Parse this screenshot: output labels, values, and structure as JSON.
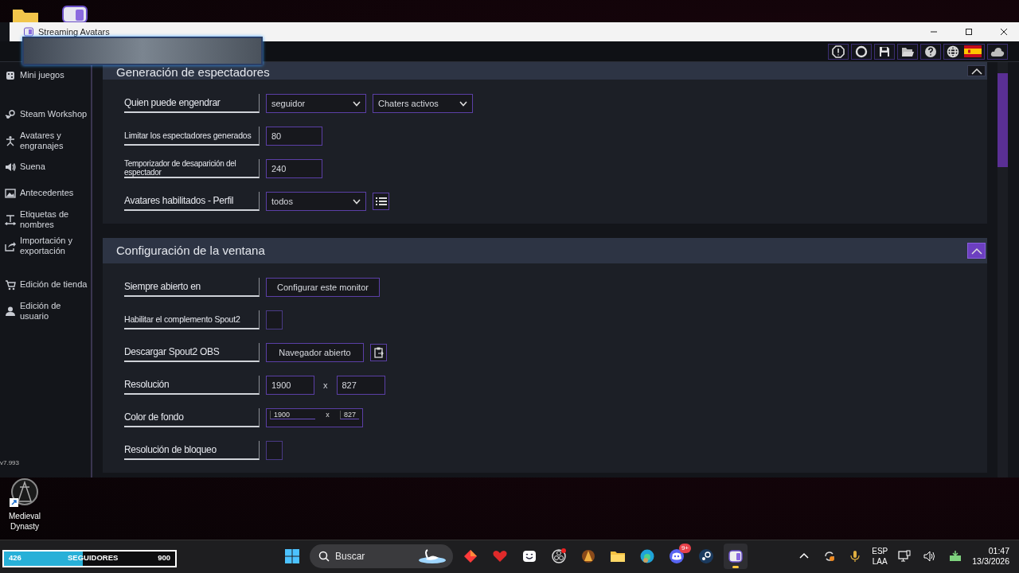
{
  "window": {
    "title": "Streaming Avatars"
  },
  "sidebar": {
    "groups": [
      {
        "items": [
          {
            "label": "Mini juegos"
          }
        ]
      },
      {
        "items": [
          {
            "label": "Steam Workshop"
          },
          {
            "label": "Avatares y engranajes"
          },
          {
            "label": "Suena"
          },
          {
            "label": "Antecedentes"
          },
          {
            "label": "Etiquetas de nombres"
          },
          {
            "label": "Importación y exportación"
          }
        ]
      },
      {
        "items": [
          {
            "label": "Edición de tienda"
          },
          {
            "label": "Edición de usuario"
          }
        ]
      }
    ]
  },
  "sections": [
    {
      "title": "Generación de espectadores",
      "expanded": true,
      "highlighted": false,
      "rows": [
        {
          "label": "Quien puede engendrar",
          "kind": "dropdown",
          "values": [
            "seguidor",
            "Chaters activos"
          ]
        },
        {
          "label": "Limitar los espectadores generados",
          "kind": "number",
          "values": [
            "80"
          ]
        },
        {
          "label": "Temporizador de desaparición del espectador",
          "kind": "number",
          "values": [
            "240"
          ]
        },
        {
          "label": "Avatares habilitados - Perfil",
          "kind": "dropdown_with_list",
          "values": [
            "todos"
          ]
        }
      ]
    },
    {
      "title": "Configuración de la ventana",
      "expanded": true,
      "highlighted": true,
      "rows": [
        {
          "label": "Siempre abierto en",
          "kind": "button",
          "values": [
            "Configurar este monitor"
          ]
        },
        {
          "label": "Habilitar el complemento Spout2",
          "kind": "checkbox",
          "checked": false
        },
        {
          "label": "Descargar Spout2 OBS",
          "kind": "button_with_clipboard",
          "values": [
            "Navegador abierto"
          ]
        },
        {
          "label": "Resolución",
          "kind": "size_pair",
          "values": [
            "1900",
            "827"
          ],
          "separator": "x"
        },
        {
          "label": "Color de fondo",
          "kind": "color_pair",
          "values": [
            "1900",
            "827"
          ],
          "separator": "x"
        },
        {
          "label": "Resolución de bloqueo",
          "kind": "checkbox",
          "checked": false
        }
      ]
    }
  ],
  "desktop": {
    "version": "v7.993",
    "shortcut": "Medieval Dynasty"
  },
  "taskbar": {
    "follower_meter": {
      "current": "426",
      "label": "SEGUIDORES",
      "goal": "900",
      "level": 0.46
    },
    "search": {
      "placeholder": "Buscar"
    },
    "discord_badge": "9+",
    "language": [
      "ESP",
      "LAA"
    ],
    "time": "01:47",
    "date": "13/3/2026"
  }
}
